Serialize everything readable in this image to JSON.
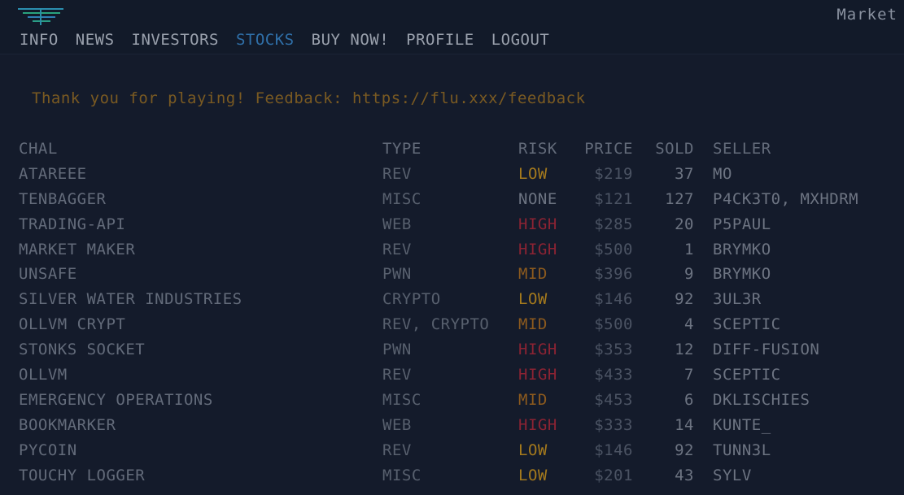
{
  "header": {
    "market_label": "Market",
    "nav": [
      {
        "label": "INFO",
        "active": false
      },
      {
        "label": "NEWS",
        "active": false
      },
      {
        "label": "INVESTORS",
        "active": false
      },
      {
        "label": "STOCKS",
        "active": true
      },
      {
        "label": "BUY NOW!",
        "active": false
      },
      {
        "label": "PROFILE",
        "active": false
      },
      {
        "label": "LOGOUT",
        "active": false
      }
    ]
  },
  "banner": "Thank you for playing! Feedback: https://flu.xxx/feedback",
  "table": {
    "columns": {
      "chal": "CHAL",
      "type": "TYPE",
      "risk": "RISK",
      "price": "PRICE",
      "sold": "SOLD",
      "seller": "SELLER"
    },
    "rows": [
      {
        "chal": "ATAREEE",
        "type": "REV",
        "risk": "LOW",
        "price": "$219",
        "sold": "37",
        "seller": "MO"
      },
      {
        "chal": "TENBAGGER",
        "type": "MISC",
        "risk": "NONE",
        "price": "$121",
        "sold": "127",
        "seller": "P4CK3T0, MXHDRM"
      },
      {
        "chal": "TRADING-API",
        "type": "WEB",
        "risk": "HIGH",
        "price": "$285",
        "sold": "20",
        "seller": "P5PAUL"
      },
      {
        "chal": "MARKET MAKER",
        "type": "REV",
        "risk": "HIGH",
        "price": "$500",
        "sold": "1",
        "seller": "BRYMKO"
      },
      {
        "chal": "UNSAFE",
        "type": "PWN",
        "risk": "MID",
        "price": "$396",
        "sold": "9",
        "seller": "BRYMKO"
      },
      {
        "chal": "SILVER WATER INDUSTRIES",
        "type": "CRYPTO",
        "risk": "LOW",
        "price": "$146",
        "sold": "92",
        "seller": "3UL3R"
      },
      {
        "chal": "OLLVM CRYPT",
        "type": "REV, CRYPTO",
        "risk": "MID",
        "price": "$500",
        "sold": "4",
        "seller": "SCEPTIC"
      },
      {
        "chal": "STONKS SOCKET",
        "type": "PWN",
        "risk": "HIGH",
        "price": "$353",
        "sold": "12",
        "seller": "DIFF-FUSION"
      },
      {
        "chal": "OLLVM",
        "type": "REV",
        "risk": "HIGH",
        "price": "$433",
        "sold": "7",
        "seller": "SCEPTIC"
      },
      {
        "chal": "EMERGENCY OPERATIONS",
        "type": "MISC",
        "risk": "MID",
        "price": "$453",
        "sold": "6",
        "seller": "DKLISCHIES"
      },
      {
        "chal": "BOOKMARKER",
        "type": "WEB",
        "risk": "HIGH",
        "price": "$333",
        "sold": "14",
        "seller": "KUNTE_"
      },
      {
        "chal": "PYCOIN",
        "type": "REV",
        "risk": "LOW",
        "price": "$146",
        "sold": "92",
        "seller": "TUNN3L"
      },
      {
        "chal": "TOUCHY LOGGER",
        "type": "MISC",
        "risk": "LOW",
        "price": "$201",
        "sold": "43",
        "seller": "SYLV"
      }
    ]
  },
  "colors": {
    "background": "#141b2b",
    "active_nav": "#2f6fa8",
    "risk_low": "#a57a1d",
    "risk_mid": "#8c5a1e",
    "risk_high": "#8b2333",
    "risk_none": "#6d7482",
    "banner": "#7a5a22"
  }
}
